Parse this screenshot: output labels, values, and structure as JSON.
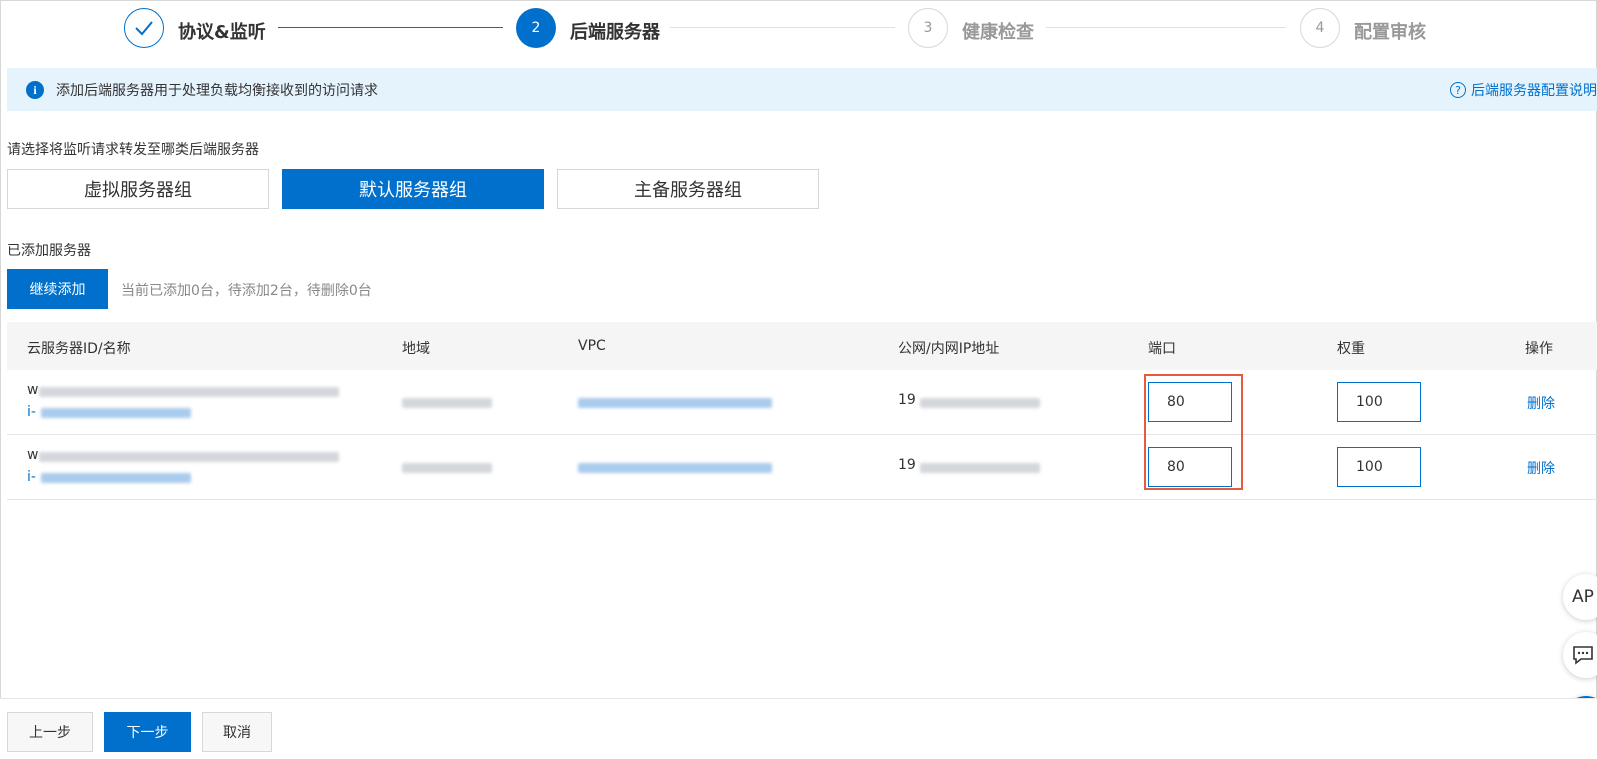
{
  "steps": [
    {
      "number": "✓",
      "label": "协议&监听",
      "status": "done"
    },
    {
      "number": "2",
      "label": "后端服务器",
      "status": "active"
    },
    {
      "number": "3",
      "label": "健康检查",
      "status": "todo"
    },
    {
      "number": "4",
      "label": "配置审核",
      "status": "todo"
    }
  ],
  "info_bar": {
    "icon": "i",
    "text": "添加后端服务器用于处理负载均衡接收到的访问请求",
    "help_icon": "?",
    "help_link": "后端服务器配置说明"
  },
  "group_prompt": "请选择将监听请求转发至哪类后端服务器",
  "group_options": [
    {
      "label": "虚拟服务器组",
      "selected": false
    },
    {
      "label": "默认服务器组",
      "selected": true
    },
    {
      "label": "主备服务器组",
      "selected": false
    }
  ],
  "added_section": {
    "title": "已添加服务器",
    "add_button": "继续添加",
    "summary": "当前已添加0台，待添加2台，待删除0台"
  },
  "table": {
    "headers": [
      "云服务器ID/名称",
      "地域",
      "VPC",
      "公网/内网IP地址",
      "端口",
      "权重",
      "操作"
    ],
    "rows": [
      {
        "name_prefix": "w",
        "id_prefix": "i-",
        "ip_prefix": "19",
        "port": "80",
        "weight": "100",
        "action": "删除"
      },
      {
        "name_prefix": "w",
        "id_prefix": "i-",
        "ip_prefix": "19",
        "port": "80",
        "weight": "100",
        "action": "删除"
      }
    ]
  },
  "footer": {
    "prev": "上一步",
    "next": "下一步",
    "cancel": "取消"
  },
  "float_buttons": {
    "api": "AP",
    "chat_icon": "chat-icon",
    "grid_icon": "grid-icon"
  },
  "colors": {
    "primary": "#0070cc",
    "info_bg": "#e5f3fd",
    "highlight": "#e85a3c"
  }
}
